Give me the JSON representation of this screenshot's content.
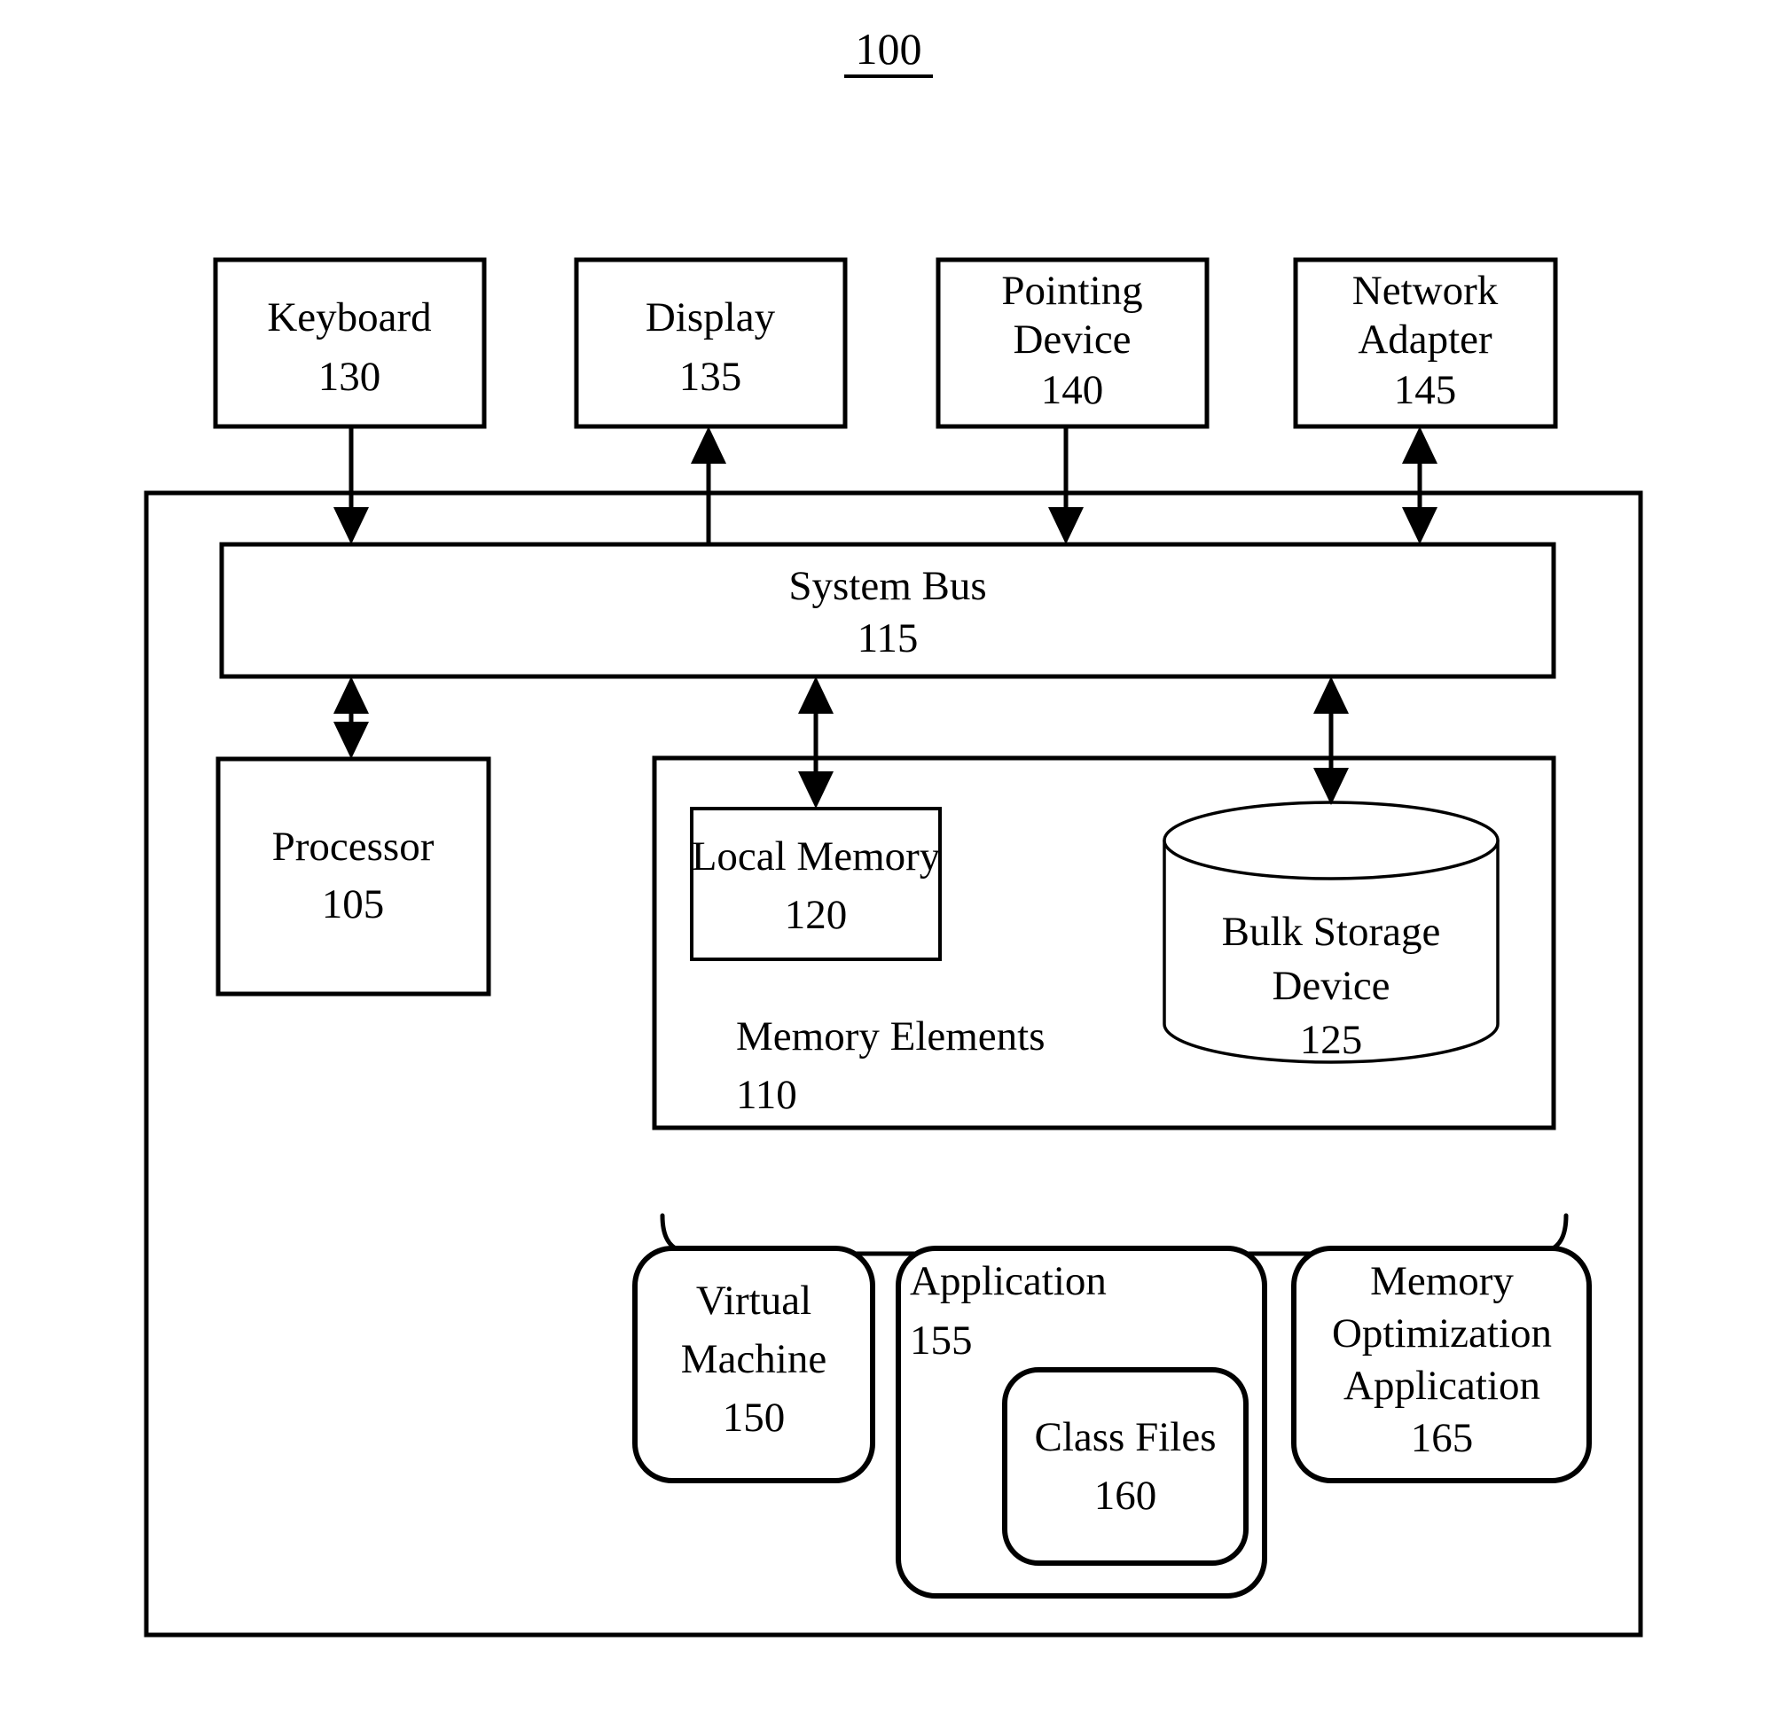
{
  "figure": {
    "number": "100",
    "number_underlined": true
  },
  "peripherals": [
    {
      "id": "keyboard",
      "label": "Keyboard",
      "ref": "130",
      "lines": [
        "Keyboard"
      ],
      "arrow": "down"
    },
    {
      "id": "display",
      "label": "Display",
      "ref": "135",
      "lines": [
        "Display"
      ],
      "arrow": "up"
    },
    {
      "id": "pointing-device",
      "label": "Pointing Device",
      "ref": "140",
      "lines": [
        "Pointing",
        "Device"
      ],
      "arrow": "down"
    },
    {
      "id": "network-adapter",
      "label": "Network Adapter",
      "ref": "145",
      "lines": [
        "Network",
        "Adapter"
      ],
      "arrow": "both"
    }
  ],
  "system_bus": {
    "label": "System Bus",
    "ref": "115"
  },
  "processor": {
    "label": "Processor",
    "ref": "105",
    "arrow": "both"
  },
  "memory_elements": {
    "label": "Memory Elements",
    "ref": "110",
    "local_memory": {
      "label": "Local Memory",
      "ref": "120",
      "arrow": "both"
    },
    "bulk_storage": {
      "lines": [
        "Bulk Storage",
        "Device"
      ],
      "label": "Bulk Storage Device",
      "ref": "125",
      "arrow": "both"
    }
  },
  "software": [
    {
      "id": "virtual-machine",
      "label": "Virtual Machine",
      "lines": [
        "Virtual",
        "Machine"
      ],
      "ref": "150",
      "align": "center"
    },
    {
      "id": "application",
      "label": "Application",
      "lines": [
        "Application"
      ],
      "ref": "155",
      "align": "start",
      "child": {
        "id": "class-files",
        "label": "Class Files",
        "lines": [
          "Class Files"
        ],
        "ref": "160",
        "align": "center"
      }
    },
    {
      "id": "memory-optimization-application",
      "label": "Memory Optimization Application",
      "lines": [
        "Memory",
        "Optimization",
        "Application"
      ],
      "ref": "165",
      "align": "center"
    }
  ],
  "colors": {
    "stroke": "#000000",
    "fill": "#ffffff"
  }
}
